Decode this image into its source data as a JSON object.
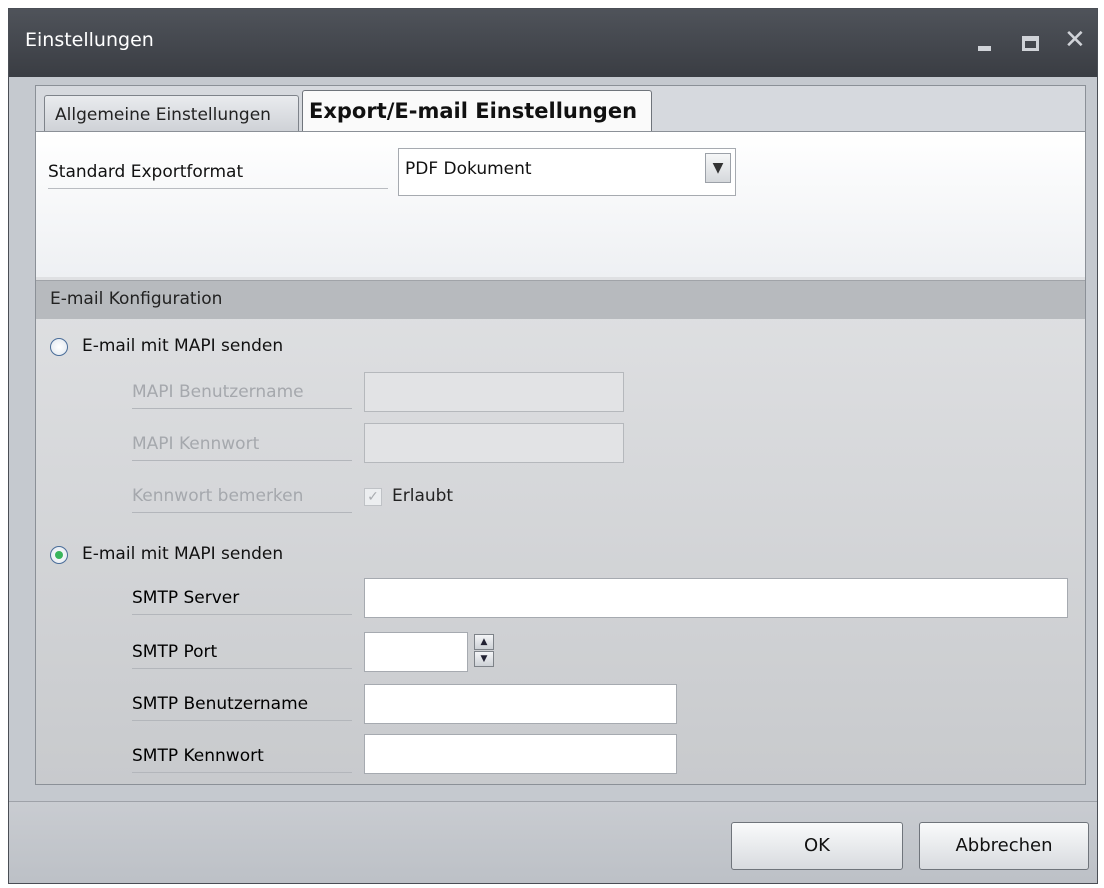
{
  "window": {
    "title": "Einstellungen",
    "controls": {
      "minimize": "minimize-icon",
      "maximize": "maximize-icon",
      "close": "close-icon"
    }
  },
  "tabs": [
    {
      "label": "Allgemeine Einstellungen",
      "active": false
    },
    {
      "label": "Export/E-mail Einstellungen",
      "active": true
    }
  ],
  "export": {
    "format_label": "Standard Exportformat",
    "format_value": "PDF Dokument"
  },
  "email": {
    "section_title": "E-mail Konfiguration",
    "mapi": {
      "radio_label": "E-mail mit MAPI senden",
      "selected": false,
      "username_label": "MAPI Benutzername",
      "password_label": "MAPI Kennwort",
      "remember_label": "Kennwort bemerken",
      "remember_option": "Erlaubt",
      "remember_checked": true
    },
    "smtp": {
      "radio_label": "E-mail mit MAPI senden",
      "selected": true,
      "server_label": "SMTP Server",
      "server_value": "",
      "port_label": "SMTP Port",
      "port_value": "",
      "username_label": "SMTP Benutzername",
      "username_value": "",
      "password_label": "SMTP Kennwort",
      "password_value": ""
    }
  },
  "buttons": {
    "ok": "OK",
    "cancel": "Abbrechen"
  },
  "colors": {
    "titlebar": "#3f4248",
    "radio_selected": "#39b55c",
    "section_header": "#b7babe"
  }
}
